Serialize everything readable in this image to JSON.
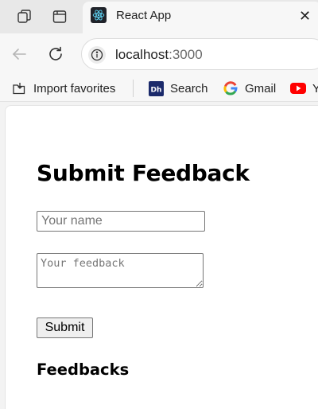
{
  "browser": {
    "tab": {
      "title": "React App",
      "close_glyph": "✕",
      "favicon": "react-logo-icon"
    },
    "address": {
      "host": "localhost",
      "port": ":3000"
    },
    "bookmarks": [
      {
        "label": "Import favorites",
        "icon": "import-favorites-icon"
      },
      {
        "label": "Search",
        "icon": "search-favicon"
      },
      {
        "label": "Gmail",
        "icon": "google-icon"
      },
      {
        "label": "Y",
        "icon": "youtube-icon"
      }
    ],
    "colors": {
      "youtube_red": "#ff0000",
      "react_cyan": "#61dafb",
      "search_navy": "#1b2a6b"
    }
  },
  "page": {
    "title": "Submit Feedback",
    "name_placeholder": "Your name",
    "feedback_placeholder": "Your feedback",
    "submit_label": "Submit",
    "list_title": "Feedbacks"
  }
}
